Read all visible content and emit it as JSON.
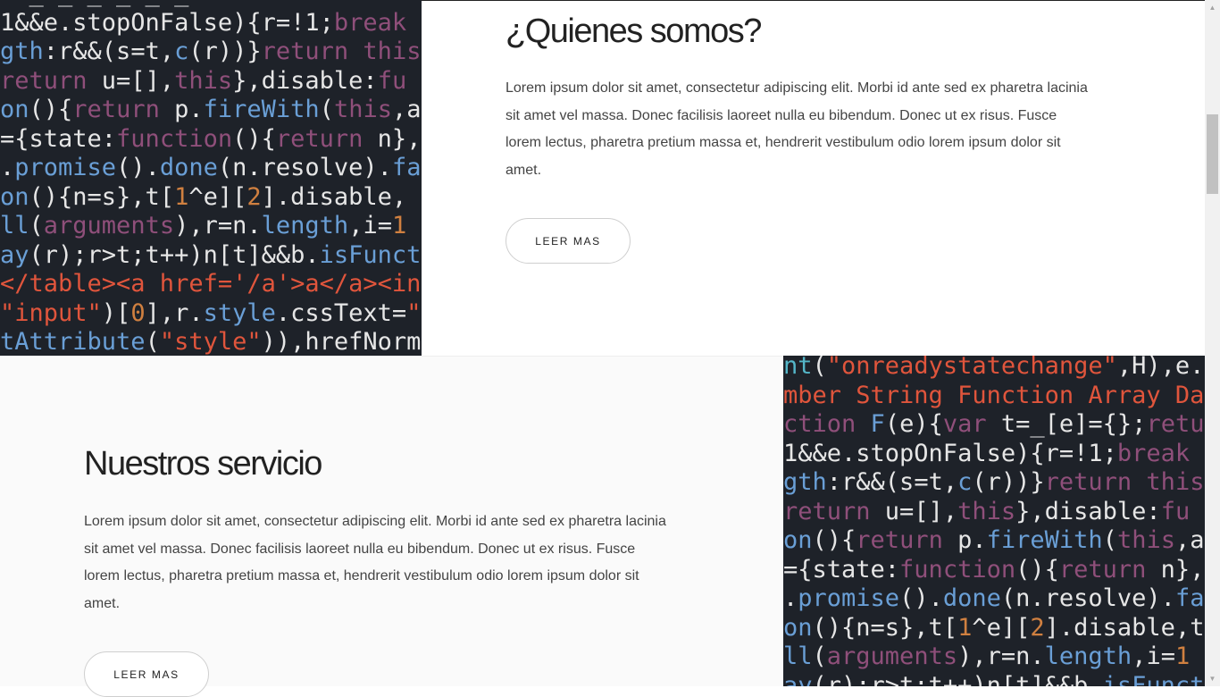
{
  "about": {
    "title": "¿Quienes somos?",
    "text": "Lorem ipsum dolor sit amet, consectetur adipiscing elit. Morbi id ante sed ex pharetra lacinia sit amet vel massa. Donec facilisis laoreet nulla eu bibendum. Donec ut ex risus. Fusce lorem lectus, pharetra pretium massa et, hendrerit vestibulum odio lorem ipsum dolor sit amet.",
    "button": "LEER MAS"
  },
  "services": {
    "title": "Nuestros servicio",
    "text": "Lorem ipsum dolor sit amet, consectetur adipiscing elit. Morbi id ante sed ex pharetra lacinia sit amet vel massa. Donec facilisis laoreet nulla eu bibendum. Donec ut ex risus. Fusce lorem lectus, pharetra pretium massa et, hendrerit vestibulum odio lorem ipsum dolor sit amet.",
    "button": "LEER MAS"
  },
  "scrollbar": {
    "up_icon": "▲",
    "down_icon": "▼"
  }
}
